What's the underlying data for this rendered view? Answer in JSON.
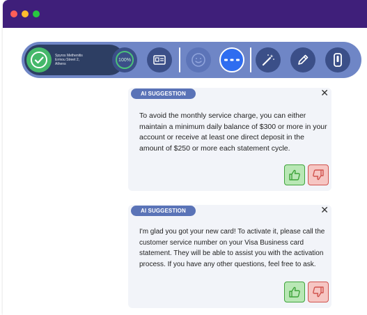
{
  "window": {
    "traffic_lights": [
      "close",
      "minimize",
      "maximize"
    ]
  },
  "toolbar": {
    "contact": {
      "name": "Spyros Methenitis",
      "address_line": "Ermou Street 2,",
      "city": "Athens",
      "icon": "check-circle-icon"
    },
    "score_label": "100%",
    "buttons": [
      "id-card-icon",
      "smiley-icon",
      "dots-icon",
      "magic-wand-icon",
      "pencil-icon",
      "phone-icon"
    ]
  },
  "suggestions": [
    {
      "badge": "AI SUGGESTION",
      "text": "To avoid the monthly service charge, you can either maintain a minimum daily balance of $300 or more in your account or receive at least one direct deposit in the amount of $250 or more each statement cycle."
    },
    {
      "badge": "AI SUGGESTION",
      "text": "I'm glad you got your new card! To activate it, please call the customer service number on your Visa Business card statement. They will be able to assist you with the activation process. If you have any other questions, feel free to ask."
    }
  ],
  "colors": {
    "titlebar": "#3f1f7a",
    "toolbar": "#6f86c6",
    "accent": "#2f6df0",
    "badge": "#5a73b7",
    "thumbs_up": "#3ea33a",
    "thumbs_down": "#d0524c"
  }
}
